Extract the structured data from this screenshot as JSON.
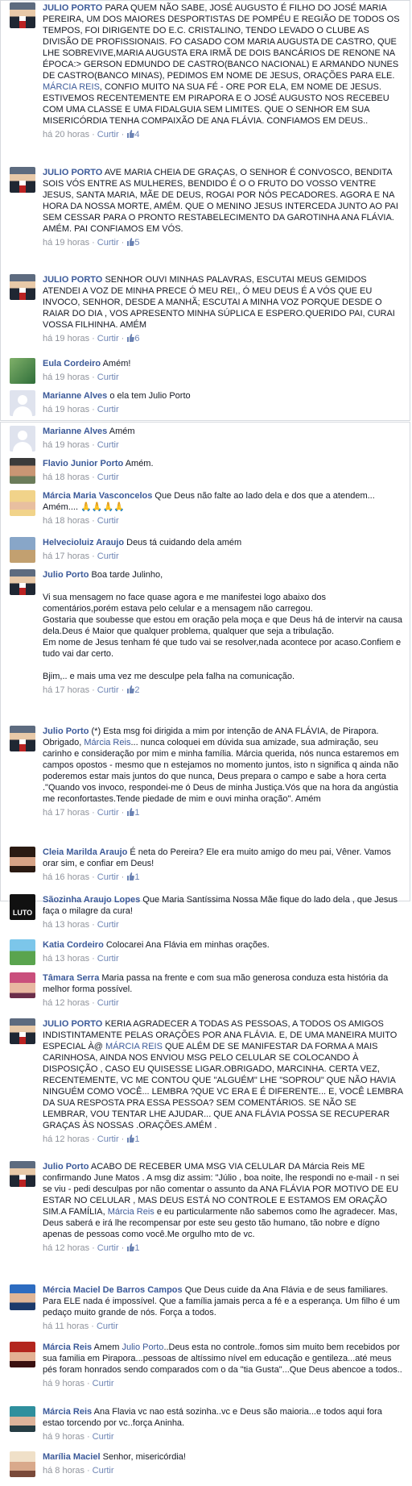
{
  "meta_labels": {
    "reply": "Curtir"
  },
  "comments": [
    {
      "author": "Julio Porto",
      "text": "PARA QUEM NÃO SABE, JOSÉ AUGUSTO É FILHO DO JOSÉ MARIA PEREIRA, UM DOS MAIORES DESPORTISTAS DE POMPÉU E REGIÃO DE TODOS OS TEMPOS, FOI DIRIGENTE DO E.C. CRISTALINO, TENDO LEVADO O CLUBE AS DIVISÃO DE PROFISSIONAIS. FO CASADO COM MARIA AUGUSTA DE CASTRO, QUE LHE SOBREVIVE,MARIA AUGUSTA ERA IRMÃ DE DOIS BANCÁRIOS DE RENONE NA ÉPOCA:> GERSON EDMUNDO DE CASTRO(BANCO NACIONAL) E ARMANDO NUNES DE CASTRO(BANCO MINAS), PEDIMOS EM NOME DE JESUS, ORAÇÕES PARA ELE.",
      "mention": "Márcia Reis",
      "text_after": ", CONFIO MUITO NA SUA FÉ - ORE POR ELA, EM NOME DE JESUS. ESTIVEMOS RECENTEMENTE EM PIRAPORA E O JOSÉ AUGUSTO NOS RECEBEU COM UMA CLASSE E UMA FIDALGUIA SEM LIMITES. QUE O SENHOR EM SUA MISERICÓRDIA TENHA COMPAIXÃO DE ANA FLÁVIA. CONFIAMOS EM DEUS..",
      "time": "há 20 horas",
      "like_label": "Curtir",
      "likes": "4"
    },
    {
      "author": "Julio Porto",
      "text": "AVE MARIA CHEIA DE GRAÇAS, O SENHOR É CONVOSCO, BENDITA SOIS VÓS ENTRE AS MULHERES, BENDIDO É O O FRUTO DO VOSSO VENTRE JESUS, SANTA MARIA, MÃE DE DEUS, ROGAI POR NÓS PECADORES. AGORA E NA HORA DA NOSSA MORTE, AMÉM. QUE O MENINO JESUS INTERCEDA JUNTO AO PAI SEM CESSAR PARA O PRONTO RESTABELECIMENTO DA GAROTINHA ANA FLÁVIA. AMÉM. PAI CONFIAMOS EM VÓS.",
      "time": "há 19 horas",
      "like_label": "Curtir",
      "likes": "5"
    },
    {
      "author": "Julio Porto",
      "text": "SENHOR OUVI MINHAS PALAVRAS, ESCUTAI MEUS GEMIDOS ATENDEI A VOZ DE MINHA PRECE Ó MEU REI,, Ó MEU DEUS É A VÓS QUE EU INVOCO, SENHOR, DESDE A MANHÃ; ESCUTAI A MINHA VOZ PORQUE DESDE O RAIAR DO DIA , VOS APRESENTO MINHA SÚPLICA E ESPERO.QUERIDO PAI, CURAI VOSSA FILHINHA. AMÉM",
      "time": "há 19 horas",
      "like_label": "Curtir",
      "likes": "6"
    },
    {
      "author": "Eula Cordeiro",
      "text": "Amém!",
      "time": "há 19 horas",
      "like_label": "Curtir"
    },
    {
      "author": "Marianne Alves",
      "text": "o ela tem Julio Porto",
      "time": "há 19 horas",
      "like_label": "Curtir"
    },
    {
      "author": "Marianne Alves",
      "text": "Amém",
      "time": "há 19 horas",
      "like_label": "Curtir"
    },
    {
      "author": "Flavio Junior Porto",
      "text": "Amém.",
      "time": "há 18 horas",
      "like_label": "Curtir"
    },
    {
      "author": "Márcia Maria Vasconcelos",
      "text": "Que Deus não falte ao lado dela e dos que a atendem... Amém.... 🙏🙏🙏🙏",
      "time": "há 18 horas",
      "like_label": "Curtir"
    },
    {
      "author": "Helvecioluiz Araujo",
      "text": "Deus tá cuidando dela amém",
      "time": "há 17 horas",
      "like_label": "Curtir"
    },
    {
      "author": "Julio Porto",
      "text": "Boa tarde Julinho,\n\nVi sua mensagem no face quase agora e me manifestei logo abaixo dos comentários,porém estava pelo celular e a mensagem não carregou.\nGostaria que soubesse que estou em oração pela moça e que Deus há de intervir na causa dela.Deus é Maior que qualquer problema, qualquer que seja a tribulação.\nEm nome de Jesus tenham fé que tudo vai se resolver,nada acontece por acaso.Confiem e tudo vai dar certo.\n\nBjim,.. e mais uma vez me desculpe pela falha na comunicação.",
      "time": "há 17 horas",
      "like_label": "Curtir",
      "likes": "2"
    },
    {
      "author": "Julio Porto",
      "text": "(*) Esta msg foi dirigida a mim por intenção de ANA FLÁVIA, de Pirapora. Obrigado,",
      "mention": "Márcia Reis",
      "text_after": "... nunca coloquei em dúvida sua amizade, sua admiração, seu carinho e consideração por mim e minha família. Márcia querida, nós nunca estaremos em campos opostos - mesmo que n estejamos no momento juntos, isto n significa q ainda não poderemos estar mais juntos do que nunca, Deus prepara o campo e sabe a hora certa .\"Quando vos invoco, respondei-me ó Deus de minha Justiça.Vós que na hora da angústia me reconfortastes.Tende piedade de mim e ouvi minha oração\". Amém",
      "time": "há 17 horas",
      "like_label": "Curtir",
      "likes": "1"
    },
    {
      "author": "Cleia Marilda Araujo",
      "text": "É neta do Pereira? Ele era muito amigo do meu pai, Vêner. Vamos orar sim, e confiar em Deus!",
      "time": "há 16 horas",
      "like_label": "Curtir",
      "likes": "1"
    },
    {
      "author": "Sãozinha Araujo Lopes",
      "text": "Que Maria Santíssima Nossa Mãe fique do lado dela , que Jesus faça o milagre da cura!",
      "time": "há 13 horas",
      "like_label": "Curtir",
      "avatar_text": "LUTO"
    },
    {
      "author": "Katia Cordeiro",
      "text": "Colocarei Ana Flávia em minhas orações.",
      "time": "há 13 horas",
      "like_label": "Curtir"
    },
    {
      "author": "Tâmara Serra",
      "text": "Maria passa na frente e com sua mão generosa conduza esta história da melhor forma possível.",
      "time": "há 12 horas",
      "like_label": "Curtir"
    },
    {
      "author": "Julio Porto",
      "text": "KERIA AGRADECER A TODAS AS PESSOAS, A TODOS OS AMIGOS INDISTINTAMENTE PELAS ORAÇÕES POR ANA FLÁVIA. E, DE UMA MANEIRA MUITO ESPECIAL À@",
      "mention": "Márcia Reis",
      "text_after": "QUE ALÉM DE SE MANIFESTAR DA FORMA A MAIS CARINHOSA, AINDA NOS ENVIOU MSG PELO CELULAR SE COLOCANDO À DISPOSIÇÃO , CASO EU QUISESSE LIGAR.OBRIGADO, MARCINHA. CERTA VEZ, RECENTEMENTE, VC ME CONTOU QUE \"ALGUÉM\" LHE \"SOPROU\" QUE NÃO HAVIA NINGUÉM COMO VOCÊ... LEMBRA ?QUE VC ERA E É DIFERENTE... E, VOCÊ LEMBRA DA SUA RESPOSTA PRA ESSA PESSOA? SEM COMENTÁRIOS. SE NÃO SE LEMBRAR, VOU TENTAR LHE AJUDAR... QUE ANA FLÁVIA POSSA SE RECUPERAR GRAÇAS ÀS NOSSAS .ORAÇÕES.AMÉM .",
      "time": "há 12 horas",
      "like_label": "Curtir",
      "likes": "1"
    },
    {
      "author": "Julio Porto",
      "text": "ACABO DE RECEBER UMA MSG VIA CELULAR DA Márcia Reis ME confirmando June Matos . A msg diz assim: \"Júlio , boa noite, lhe respondi no e-mail - n sei se viu - pedi desculpas por não comentar o assunto da ANA FLÁVIA POR MOTIVO DE EU ESTAR NO CELULAR , MAS DEUS ESTÁ NO CONTROLE E ESTAMOS EM ORAÇÃO SIM.A FAMÍLIA,",
      "mention": "Márcia Reis",
      "text_after": "e eu particularmente não sabemos como lhe agradecer. Mas, Deus saberá e irá lhe recompensar por este seu gesto tão humano, tão nobre e dígno apenas de pessoas como você.Me orgulho mto de vc.",
      "time": "há 12 horas",
      "like_label": "Curtir",
      "likes": "1"
    },
    {
      "author": "Mércia Maciel De Barros Campos",
      "text": "Que Deus cuide da Ana Flávia e de seus familiares. Para ELE nada é impossível. Que a família jamais perca a fé e a esperança. Um filho é um pedaço muito grande de nós. Força a todos.",
      "time": "há 11 horas",
      "like_label": "Curtir"
    },
    {
      "author": "Márcia Reis",
      "text": "Amem",
      "mention": "Julio Porto",
      "text_after": "..Deus esta no controle..fomos sim muito bem recebidos por sua familia em Pirapora...pessoas de altíssimo nível em educação e gentileza...até meus pés foram honrados sendo comparados com o da \"tia Gusta\"...Que Deus abencoe a todos..",
      "time": "há 9 horas",
      "like_label": "Curtir"
    },
    {
      "author": "Márcia Reis",
      "text": "Ana Flavia vc nao está sozinha..vc e Deus são maioria...e todos aqui fora estao torcendo por vc..força Aninha.",
      "time": "há 9 horas",
      "like_label": "Curtir"
    },
    {
      "author": "Marília Maciel",
      "text": "Senhor, misericórdia!",
      "time": "há 8 horas",
      "like_label": "Curtir"
    }
  ]
}
